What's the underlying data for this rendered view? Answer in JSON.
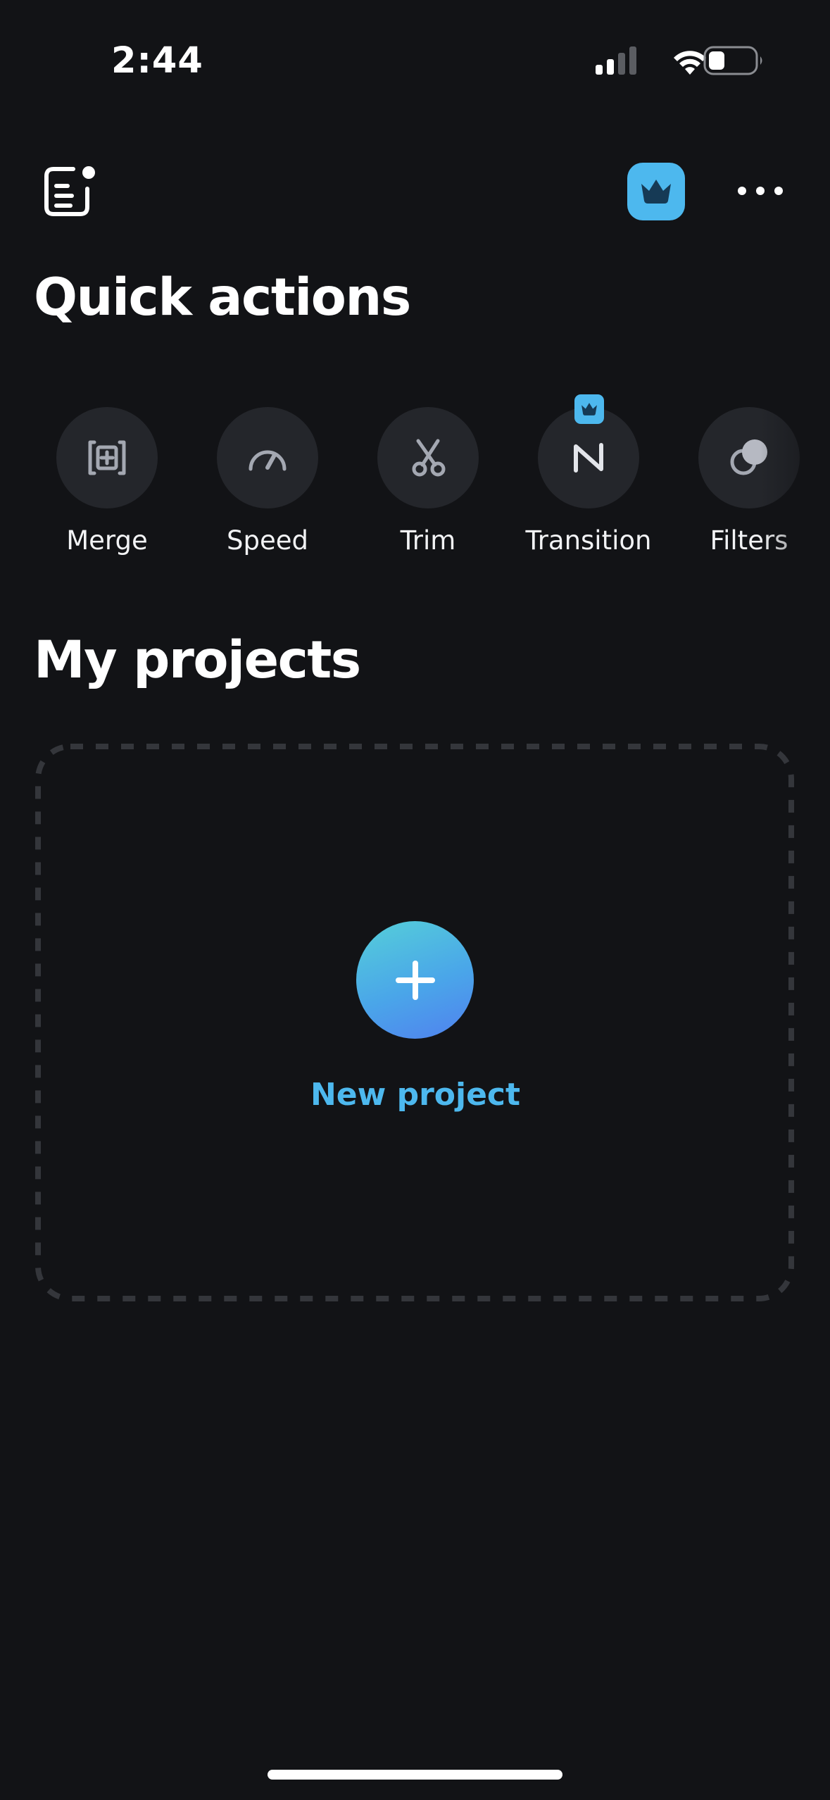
{
  "status_bar": {
    "time": "2:44"
  },
  "header": {
    "notes_icon": "notes-icon",
    "premium_icon": "crown-icon",
    "more_icon": "more-icon",
    "accent_color": "#4db8ee"
  },
  "quick_actions": {
    "title": "Quick actions",
    "items": [
      {
        "label": "Merge",
        "icon": "merge-icon",
        "pro": false
      },
      {
        "label": "Speed",
        "icon": "speed-icon",
        "pro": false
      },
      {
        "label": "Trim",
        "icon": "scissors-icon",
        "pro": false
      },
      {
        "label": "Transition",
        "icon": "transition-icon",
        "pro": true
      },
      {
        "label": "Filters",
        "icon": "filters-icon",
        "pro": false
      }
    ]
  },
  "projects": {
    "title": "My projects",
    "new_project_label": "New project",
    "new_project_icon": "plus-icon"
  }
}
